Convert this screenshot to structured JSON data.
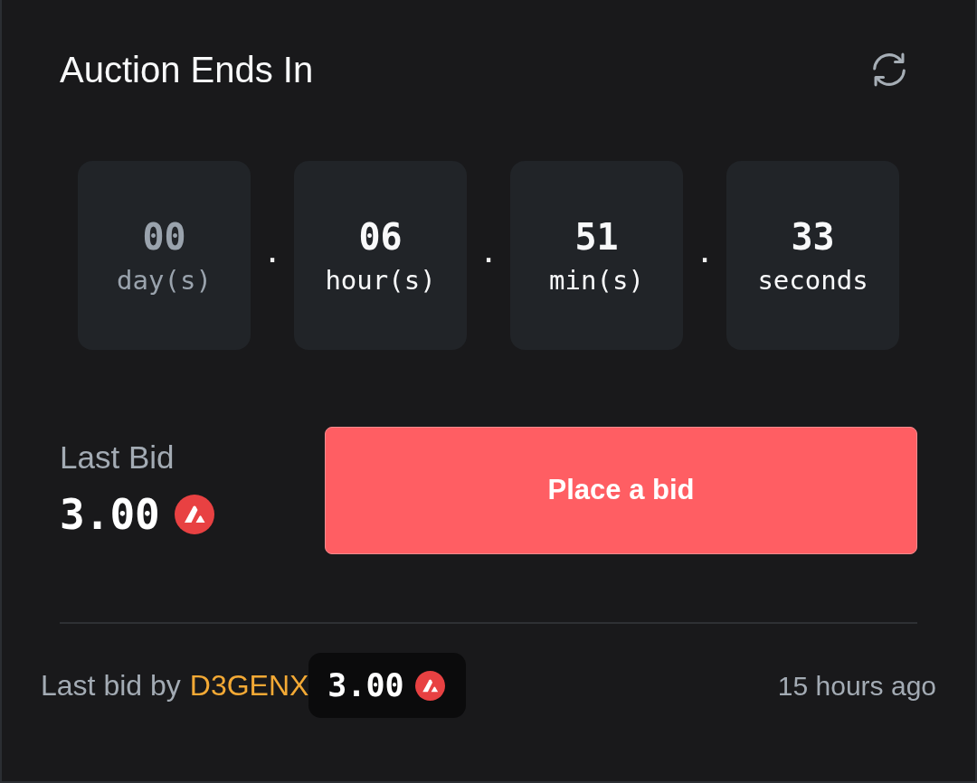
{
  "header": {
    "title": "Auction Ends In"
  },
  "countdown": [
    {
      "kind": "unit",
      "value": "00",
      "unit": "day(s)",
      "dimmed": true
    },
    {
      "kind": "separator",
      "text": "."
    },
    {
      "kind": "unit",
      "value": "06",
      "unit": "hour(s)",
      "dimmed": false
    },
    {
      "kind": "separator",
      "text": "."
    },
    {
      "kind": "unit",
      "value": "51",
      "unit": "min(s)",
      "dimmed": false
    },
    {
      "kind": "separator",
      "text": "."
    },
    {
      "kind": "unit",
      "value": "33",
      "unit": "seconds",
      "dimmed": false
    }
  ],
  "last_bid": {
    "label": "Last Bid",
    "amount": "3.00"
  },
  "bid_button": {
    "label": "Place a bid"
  },
  "footer": {
    "prefix": "Last bid by",
    "bidder": "D3GENX",
    "amount": "3.00",
    "time": "15 hours ago"
  }
}
